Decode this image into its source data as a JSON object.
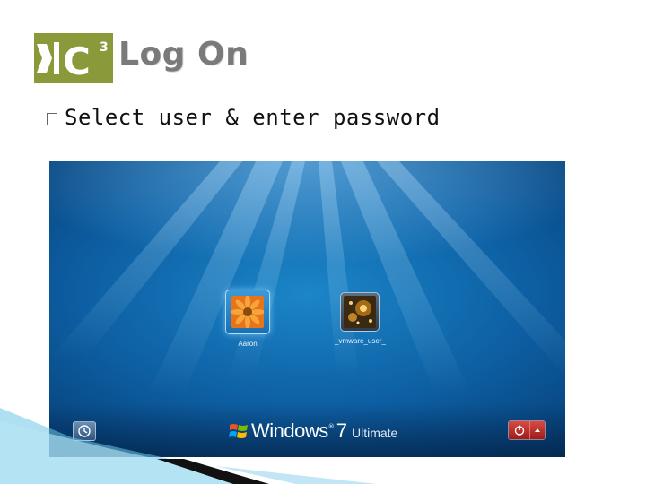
{
  "slide": {
    "logo_text": "C",
    "logo_superscript": "3",
    "title": "Log On",
    "bullet": "Select user & enter password"
  },
  "logon_screen": {
    "users": [
      {
        "name": "Aaron",
        "picture": "flower-picture",
        "selected": true
      },
      {
        "name": "_vmware_user_",
        "picture": "fireworks-picture",
        "selected": false
      }
    ],
    "branding": {
      "product": "Windows",
      "trademark": "®",
      "version": "7",
      "edition": "Ultimate"
    },
    "icons": {
      "ease_of_access": "ease-of-access-icon",
      "shutdown": "power-icon",
      "shutdown_options": "arrow-up-icon",
      "windows_logo": "windows-flag-icon"
    },
    "colors": {
      "background": "#0d5ea2",
      "power_button": "#c0302b",
      "logo_green": "#8a9a3a"
    }
  }
}
